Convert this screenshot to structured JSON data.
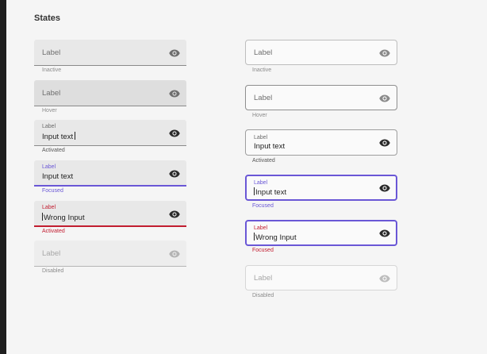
{
  "title": "States",
  "icon": "eye-icon",
  "colors": {
    "focus": "#6a57d6",
    "error": "#c21d30",
    "fill": "#e8e8e8",
    "background": "#f5f5f5"
  },
  "filled": [
    {
      "label": "Label",
      "value": "",
      "helper": "Inactive"
    },
    {
      "label": "Label",
      "value": "",
      "helper": "Hover"
    },
    {
      "label": "Label",
      "value": "Input text",
      "helper": "Activated"
    },
    {
      "label": "Label",
      "value": "Input text",
      "helper": "Focused"
    },
    {
      "label": "Label",
      "value": "Wrong Input",
      "helper": "Activated"
    },
    {
      "label": "Label",
      "value": "",
      "helper": "Disabled"
    }
  ],
  "outlined": [
    {
      "label": "Label",
      "value": "",
      "helper": "Inactive"
    },
    {
      "label": "Label",
      "value": "",
      "helper": "Hover"
    },
    {
      "label": "Label",
      "value": "Input text",
      "helper": "Activated"
    },
    {
      "label": "Label",
      "value": "Input text",
      "helper": "Focused"
    },
    {
      "label": "Label",
      "value": "Wrong Input",
      "helper": "Focused"
    },
    {
      "label": "Label",
      "value": "",
      "helper": "Disabled"
    }
  ]
}
